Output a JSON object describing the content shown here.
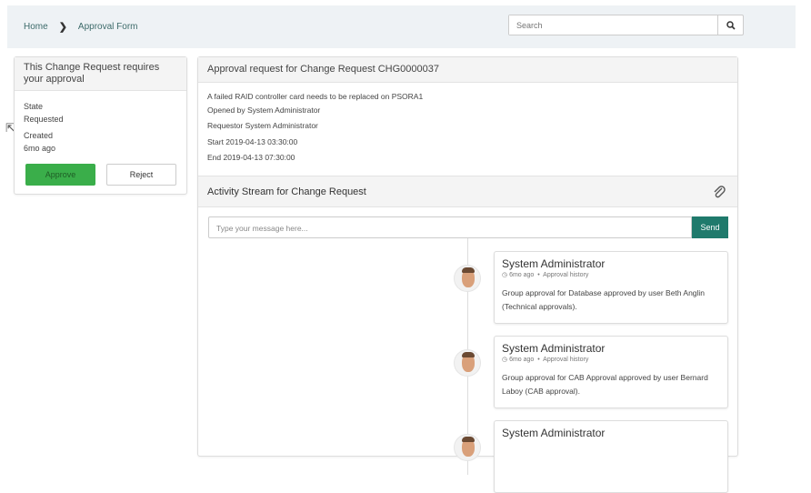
{
  "breadcrumb": {
    "home": "Home",
    "current": "Approval Form"
  },
  "search": {
    "placeholder": "Search"
  },
  "approval_card": {
    "title": "This Change Request requires your approval",
    "state_label": "State",
    "state_value": "Requested",
    "created_label": "Created",
    "created_value": "6mo ago",
    "approve": "Approve",
    "reject": "Reject"
  },
  "request": {
    "title": "Approval request for Change Request CHG0000037",
    "description": "A failed RAID controller card needs to be replaced on PSORA1",
    "opened_by": "Opened by System Administrator",
    "requestor": "Requestor System Administrator",
    "start": "Start 2019-04-13 03:30:00",
    "end": "End 2019-04-13 07:30:00"
  },
  "activity": {
    "title": "Activity Stream for Change Request",
    "message_placeholder": "Type your message here...",
    "send": "Send",
    "entries": [
      {
        "author": "System Administrator",
        "time": "6mo ago",
        "type": "Approval history",
        "text": "Group approval for Database approved by user Beth Anglin (Technical approvals)."
      },
      {
        "author": "System Administrator",
        "time": "6mo ago",
        "type": "Approval history",
        "text": "Group approval for CAB Approval approved by user Bernard Laboy (CAB approval)."
      },
      {
        "author": "System Administrator"
      }
    ]
  },
  "colors": {
    "approve": "#3aae4a",
    "send": "#1f7a6c",
    "header": "#eef2f5"
  }
}
